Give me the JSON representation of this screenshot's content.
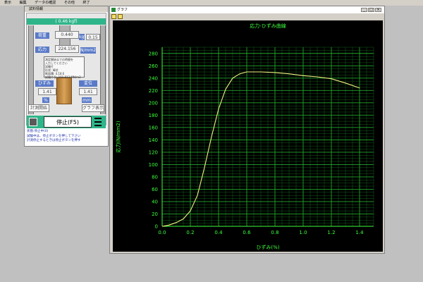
{
  "menubar": {
    "items": [
      "表示",
      "編集",
      "データの確認",
      "その他",
      "終了"
    ]
  },
  "left_panel": {
    "title": "試料情報",
    "load_display": "( 0.46 kgf)",
    "load_label": "荷重",
    "load_value": "0.440",
    "load_unit_label": "kgf",
    "load_side_value": "0.15",
    "stress_label": "応力",
    "stress_value": "224.156",
    "stress_unit": "N/mm2",
    "info_lines": [
      "測定開始までの時間を",
      "入力してください",
      "試験片",
      "形状: 棒状",
      "断面積: 4.18 E",
      "試験片長: 101.813 MN/m2"
    ],
    "strain_label": "ひずみ",
    "displacement_label": "変位",
    "strain_value": "1.41",
    "displacement_value": "1.41",
    "unit_percent": "%",
    "unit_mm": "mm",
    "measure_start_button": "計測開始",
    "graph_display_button": "グラフ表示",
    "stop_button": "停止(F5)",
    "status_lines": [
      "状態:停止中(0)",
      "試験中は、停止ボタンを押して下さい",
      "計測停止するときは停止ボタンを押す"
    ]
  },
  "graph_window": {
    "title": "グラフ",
    "window_buttons": [
      "_",
      "□",
      "×"
    ]
  },
  "chart_data": {
    "type": "line",
    "title": "応力-ひずみ曲線",
    "xlabel": "ひずみ(%)",
    "ylabel": "応力(N/mm2)",
    "xlim": [
      0,
      1.5
    ],
    "ylim": [
      0,
      290
    ],
    "x_ticks": [
      "0.0",
      "0.2",
      "0.4",
      "0.6",
      "0.8",
      "1.0",
      "1.2",
      "1.4"
    ],
    "y_ticks": [
      "0",
      "20",
      "40",
      "60",
      "80",
      "100",
      "120",
      "140",
      "160",
      "180",
      "200",
      "220",
      "240",
      "260",
      "280"
    ],
    "grid": true,
    "colors": {
      "background": "#000000",
      "grid": "#1fa62a",
      "axis_text": "#3dff3d",
      "line": "#f0f080"
    },
    "series": [
      {
        "x": [
          0.0,
          0.05,
          0.1,
          0.15,
          0.2,
          0.25,
          0.3,
          0.35,
          0.4,
          0.45,
          0.5,
          0.55,
          0.6,
          0.65,
          0.7,
          0.8,
          0.9,
          1.0,
          1.1,
          1.2,
          1.3,
          1.4
        ],
        "values": [
          0,
          2,
          6,
          12,
          25,
          50,
          95,
          145,
          190,
          222,
          240,
          247,
          250,
          250,
          250,
          249,
          247,
          244,
          242,
          239,
          232,
          224
        ]
      }
    ]
  }
}
